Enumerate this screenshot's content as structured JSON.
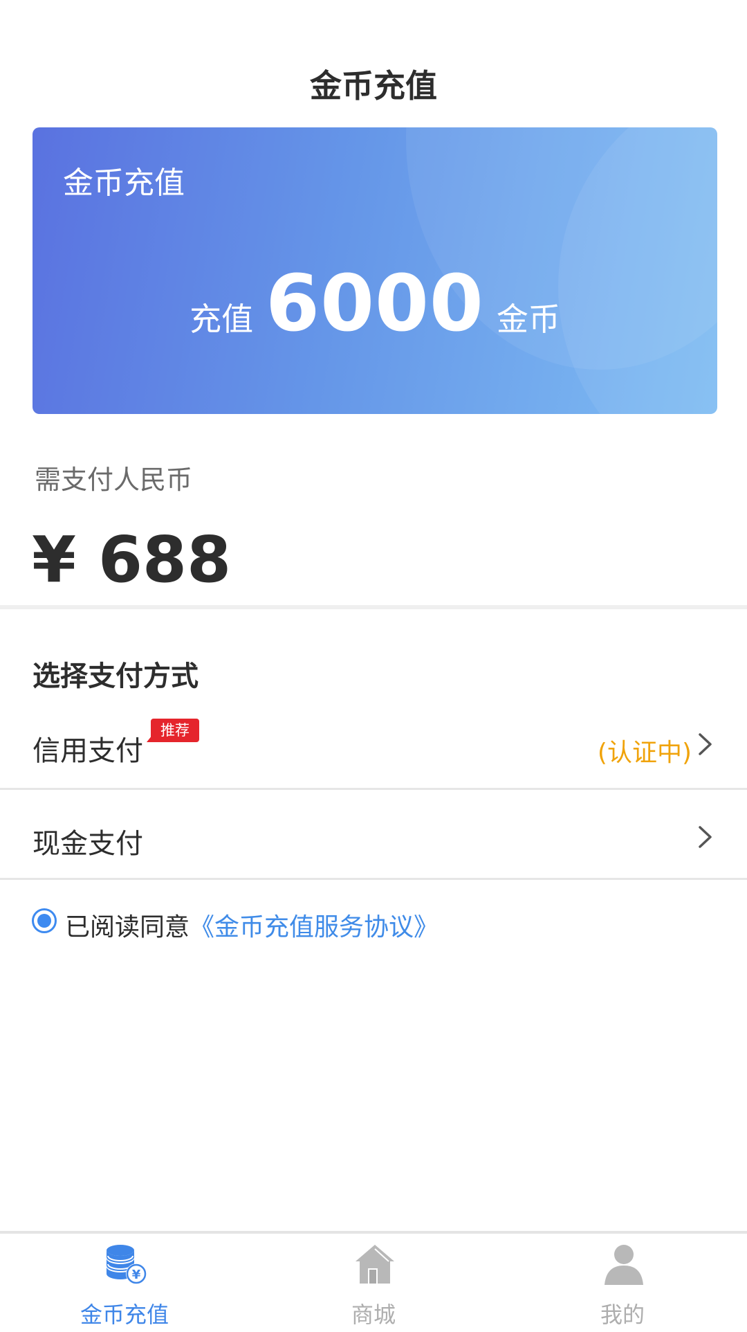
{
  "header": {
    "title": "金币充值"
  },
  "card": {
    "label": "金币充值",
    "prefix": "充值",
    "amount": "6000",
    "suffix": "金币"
  },
  "payment": {
    "label": "需支付人民币",
    "amount": "¥ 688"
  },
  "methods": {
    "title": "选择支付方式",
    "credit": {
      "label": "信用支付",
      "badge": "推荐",
      "status": "(认证中)"
    },
    "cash": {
      "label": "现金支付"
    }
  },
  "agreement": {
    "checked": true,
    "text": "已阅读同意",
    "link": "《金币充值服务协议》"
  },
  "tabbar": [
    {
      "label": "金币充值",
      "icon": "coins-icon",
      "active": true
    },
    {
      "label": "商城",
      "icon": "home-icon",
      "active": false
    },
    {
      "label": "我的",
      "icon": "user-icon",
      "active": false
    }
  ],
  "colors": {
    "accent": "#3f86e8",
    "badge": "#e5252c",
    "status": "#f0a30a",
    "card_start": "#5a72e0",
    "card_end": "#7fbdf3"
  }
}
